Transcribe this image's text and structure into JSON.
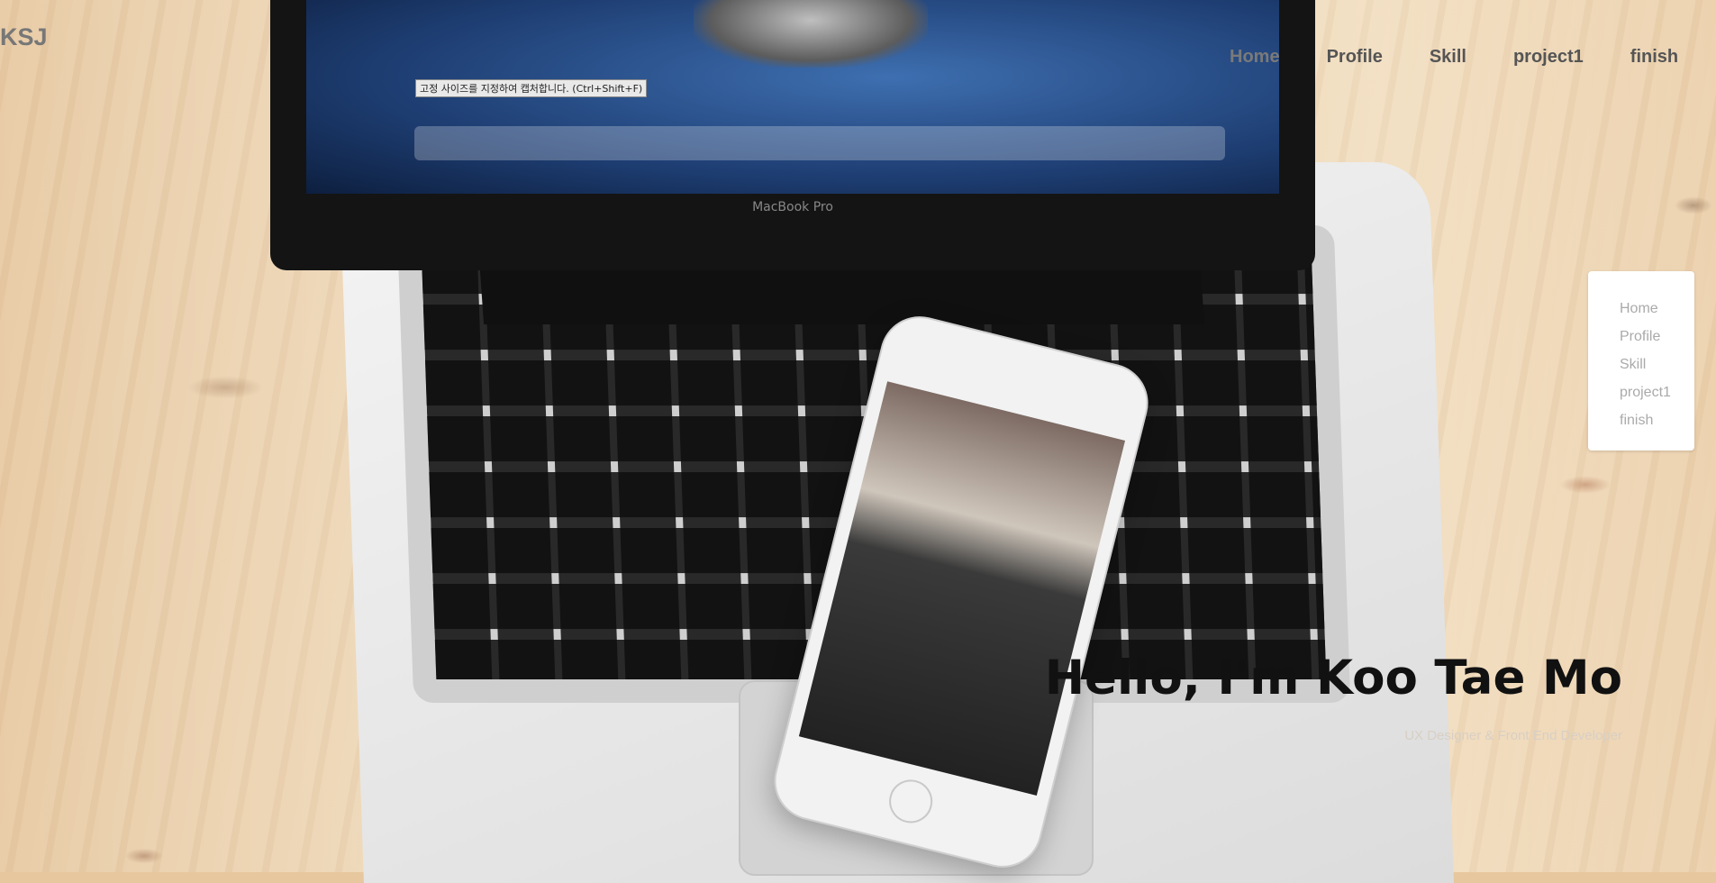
{
  "header": {
    "logo": "KSJ",
    "nav": [
      {
        "label": "Home",
        "active": true
      },
      {
        "label": "Profile"
      },
      {
        "label": "Skill"
      },
      {
        "label": "project1"
      },
      {
        "label": "finish"
      }
    ]
  },
  "tooltip": "고정 사이즈를 지정하여 캡처합니다. (Ctrl+Shift+F)",
  "sidenav": [
    "Home",
    "Profile",
    "Skill",
    "project1",
    "finish"
  ],
  "hero": {
    "title": "Hello, I'm Koo Tae Mo",
    "subtitle": "UX Designer & Front End Developer",
    "background_image_label": "MacBook Pro"
  },
  "colors": {
    "nav_text": "#555555",
    "nav_active": "#7a7a7a",
    "hero_title": "#111111",
    "sidenav_text": "#aaaaaa"
  }
}
